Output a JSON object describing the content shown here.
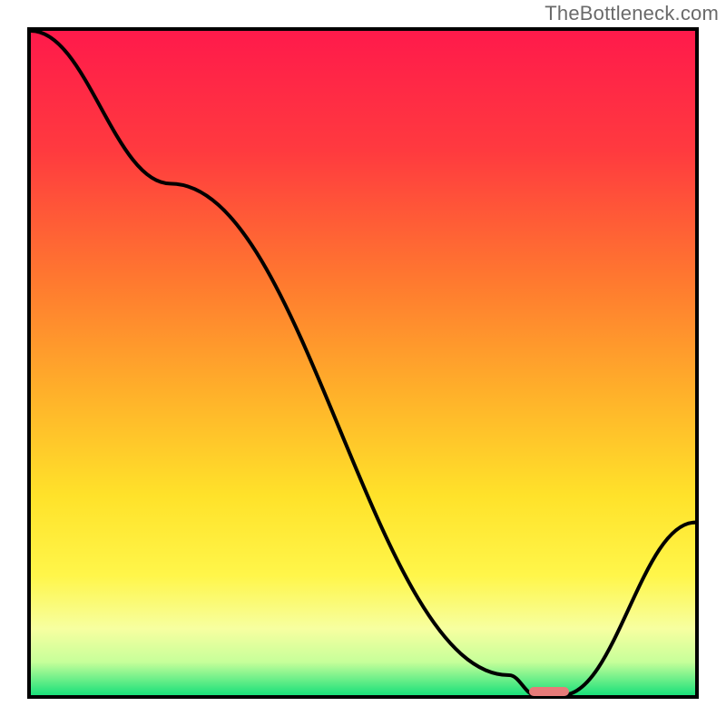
{
  "watermark": "TheBottleneck.com",
  "chart_data": {
    "type": "line",
    "title": "",
    "xlabel": "",
    "ylabel": "",
    "xlim": [
      0,
      100
    ],
    "ylim": [
      0,
      100
    ],
    "grid": false,
    "background": {
      "type": "vertical-gradient",
      "stops": [
        {
          "pct": 0,
          "color": "#ff1a4b"
        },
        {
          "pct": 18,
          "color": "#ff3a3f"
        },
        {
          "pct": 38,
          "color": "#ff7a2f"
        },
        {
          "pct": 55,
          "color": "#ffb22a"
        },
        {
          "pct": 70,
          "color": "#ffe22a"
        },
        {
          "pct": 82,
          "color": "#fff64a"
        },
        {
          "pct": 90,
          "color": "#f7ffa0"
        },
        {
          "pct": 95,
          "color": "#c7ff9a"
        },
        {
          "pct": 100,
          "color": "#19e07a"
        }
      ]
    },
    "series": [
      {
        "name": "bottleneck-curve",
        "x": [
          0,
          21,
          72,
          76,
          80,
          100
        ],
        "values": [
          100,
          77,
          3,
          0,
          0,
          26
        ]
      }
    ],
    "marker": {
      "name": "optimal-range",
      "x_start": 75,
      "x_end": 81,
      "y": 0,
      "color": "#e77b79"
    }
  }
}
